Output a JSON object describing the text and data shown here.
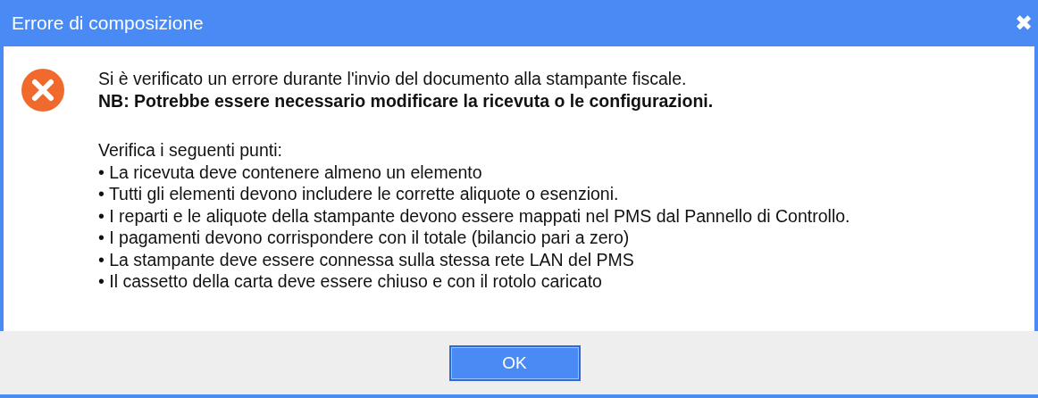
{
  "window": {
    "title": "Errore di composizione",
    "close": "✖"
  },
  "message": "Si è verificato un errore durante l'invio del documento alla stampante fiscale.",
  "note": "NB: Potrebbe essere necessario modificare la ricevuta o le configurazioni.",
  "checks_title": "Verifica i seguenti punti:",
  "checks": [
    "• La ricevuta deve contenere almeno un elemento",
    "• Tutti gli elementi devono includere le corrette aliquote o esenzioni.",
    "• I reparti e le aliquote della stampante devono essere mappati nel PMS dal Pannello di Controllo.",
    "• I pagamenti devono corrispondere con il totale (bilancio pari a zero)",
    "• La stampante deve essere connessa sulla stessa rete LAN del PMS",
    "• Il cassetto della carta deve essere chiuso e con il rotolo caricato"
  ],
  "buttons": [
    "OK"
  ]
}
